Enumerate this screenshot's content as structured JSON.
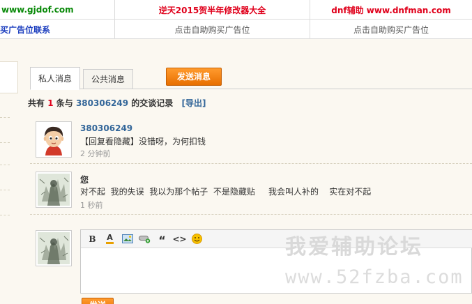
{
  "ads": {
    "row1": [
      {
        "text": "www.gjdof.com",
        "color": "#0a8a0a"
      },
      {
        "text": "逆天2015贺半年修改器大全",
        "color": "#e0001b"
      },
      {
        "text": "dnf辅助 www.dnfman.com",
        "color": "#e0001b"
      }
    ],
    "row2": [
      {
        "text": "购买广告位联系",
        "color": "#1d3fbf"
      },
      {
        "text": "点击自助购买广告位",
        "color": "#555555"
      },
      {
        "text": "点击自助购买广告位",
        "color": "#555555"
      }
    ]
  },
  "tabs": {
    "private": "私人消息",
    "public": "公共消息",
    "send": "发送消息"
  },
  "summary": {
    "prefix": "共有",
    "count": "1",
    "middle": "条与",
    "uid": "380306249",
    "suffix": "的交谈记录",
    "export": "[导出]"
  },
  "messages": [
    {
      "author": "380306249",
      "body": "【回复看隐藏】没错呀，为何扣钱",
      "time": "2 分钟前",
      "avatar": "cartoon-boy-avatar"
    },
    {
      "author": "您",
      "body": "对不起  我的失误  我以为那个帖子  不是隐藏贴     我会叫人补的    实在对不起",
      "time": "1 秒前",
      "avatar": "sketch-figure-avatar"
    }
  ],
  "editor": {
    "tools": [
      "B",
      "A",
      "image",
      "link",
      "“",
      "<>",
      "smiley"
    ],
    "submit": "发送"
  },
  "watermark": {
    "line1": "我爱辅助论坛",
    "line2": "www.52fzba.com"
  },
  "colors": {
    "accent": "#ff8c1a",
    "link": "#336699",
    "highlight": "#e0001b"
  }
}
